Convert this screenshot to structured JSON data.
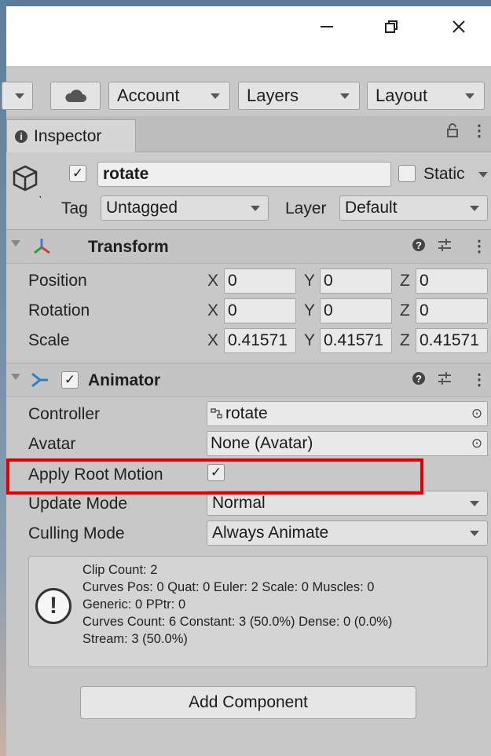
{
  "toolbar": {
    "account_label": "Account",
    "layers_label": "Layers",
    "layout_label": "Layout"
  },
  "tab": {
    "label": "Inspector"
  },
  "object": {
    "name": "rotate",
    "static_label": "Static",
    "tag_label": "Tag",
    "tag_value": "Untagged",
    "layer_label": "Layer",
    "layer_value": "Default"
  },
  "transform": {
    "title": "Transform",
    "rows": [
      {
        "label": "Position",
        "x": "0",
        "y": "0",
        "z": "0"
      },
      {
        "label": "Rotation",
        "x": "0",
        "y": "0",
        "z": "0"
      },
      {
        "label": "Scale",
        "x": "0.41571",
        "y": "0.41571",
        "z": "0.41571"
      }
    ],
    "axis": {
      "x": "X",
      "y": "Y",
      "z": "Z"
    }
  },
  "animator": {
    "title": "Animator",
    "controller_label": "Controller",
    "controller_value": "rotate",
    "avatar_label": "Avatar",
    "avatar_value": "None (Avatar)",
    "apply_root_motion_label": "Apply Root Motion",
    "apply_root_motion_checked": true,
    "update_mode_label": "Update Mode",
    "update_mode_value": "Normal",
    "culling_mode_label": "Culling Mode",
    "culling_mode_value": "Always Animate",
    "info": {
      "line1": "Clip Count: 2",
      "line2": "Curves Pos: 0 Quat: 0 Euler: 2 Scale: 0 Muscles: 0",
      "line3": "Generic: 0 PPtr: 0",
      "line4": "Curves Count: 6 Constant: 3 (50.0%) Dense: 0 (0.0%)",
      "line5": "Stream: 3 (50.0%)"
    }
  },
  "add_component_label": "Add Component",
  "colors": {
    "highlight": "#e00000",
    "panel": "#c8c8c8"
  }
}
